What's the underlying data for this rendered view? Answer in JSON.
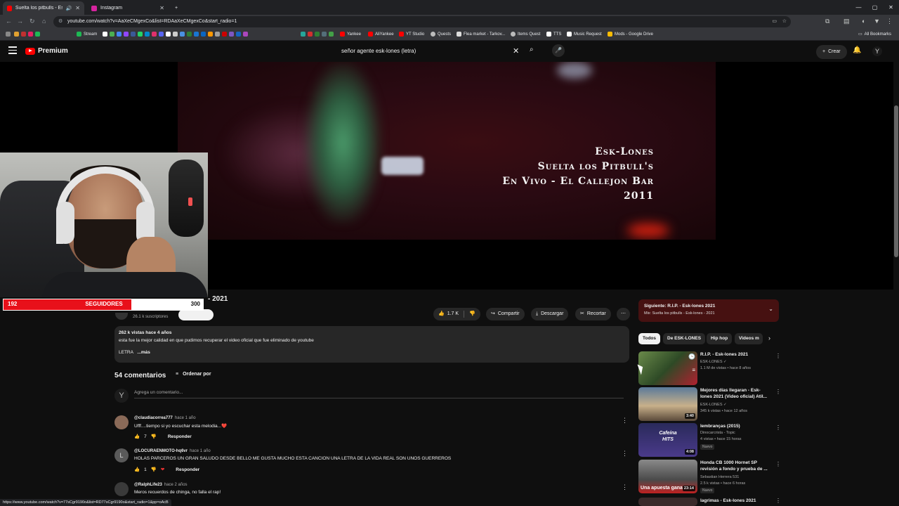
{
  "browser": {
    "tabs": [
      {
        "title": "Suelta los pitbulls - Esk-lones",
        "active": true
      },
      {
        "title": "Instagram",
        "active": false
      }
    ],
    "url": "youtube.com/watch?v=AaXeCMgexCo&list=RDAaXeCMgexCo&start_radio=1",
    "bookmarks": [
      "Stream",
      "Yankee",
      "AliYankee",
      "YT Studio",
      "Quests",
      "Flea market - Tarkov...",
      "Items Quest",
      "TTS",
      "Music Request",
      "Mods - Google Drive"
    ],
    "all_bookmarks": "All Bookmarks",
    "status_url": "https://www.youtube.com/watch?v=77sCgr9190o&list=RD77sCgr9190o&start_radio=1&pp=oAcB"
  },
  "youtube": {
    "logo_text": "Premium",
    "search_query": "señor agente esk-lones (letra)",
    "create_label": "Crear"
  },
  "video": {
    "caption_lines": [
      "Esk-Lones",
      "Suelta los Pitbull's",
      "En Vivo - El Callejon Bar",
      "2011"
    ],
    "title_visible": "- 2021",
    "subscribers": "26.1 k suscriptores",
    "likes": "1.7 K",
    "share_label": "Compartir",
    "download_label": "Descargar",
    "clip_label": "Recortar",
    "description": {
      "stats": "262 k vistas  hace 4 años",
      "text": "esta fue la mejor calidad en que pudimos recuperar el video oficial que fue eliminado de youtube",
      "lyrics": "LETRA",
      "more": "...más"
    }
  },
  "overlay": {
    "followers_current": "192",
    "followers_label": "SEGUIDORES",
    "followers_goal": "300",
    "progress_fraction": 0.64
  },
  "comments": {
    "count_label": "54 comentarios",
    "sort_label": "Ordenar por",
    "add_placeholder": "Agrega un comentario...",
    "reply_label": "Responder",
    "items": [
      {
        "author": "@claudiacorrea777",
        "time": "hace 1 año",
        "text": "Ufff....tiempo si yo escuchar esta melodia...❤️",
        "likes": "7"
      },
      {
        "author": "@LOCURAENMOTO-hq6vr",
        "time": "hace 1 año",
        "text": "HOLAS PARCEROS UN  GRAN SALUDO DESDE BELLO ME GUSTA MUCHO ESTA CANCION UNA LETRA  DE LA VIDA REAL SON UNOS GUERREROS",
        "likes": "1",
        "avatar_letter": "L"
      },
      {
        "author": "@RalphLife23",
        "time": "hace 2 años",
        "text": "Meros recuerdos de chinga, no falla el rap!",
        "likes": ""
      }
    ]
  },
  "sidebar": {
    "next_label": "Siguiente: R.I.P. - Esk-lones 2021",
    "next_sub": "Mix: Suelta los pitbulls - Esk-lones - 2021",
    "chips": [
      "Todos",
      "De ESK-LONES",
      "Hip hop",
      "Videos m"
    ],
    "recommendations": [
      {
        "title": "R.I.P. - Esk-lones 2021",
        "channel": "ESK-LONES ✓",
        "meta": "1.1 M de vistas • hace 8 años",
        "duration": ""
      },
      {
        "title": "Mejores días llegaran - Esk-lones 2021 (Video oficial) Atil...",
        "channel": "ESK-LONES ✓",
        "meta": "345 k vistas • hace 12 años",
        "duration": "3:40"
      },
      {
        "title": "lembranças (2015)",
        "channel": "Dinocarcrista - Topic",
        "meta": "4 vistas • hace 15 horas",
        "duration": "4:08",
        "badge": "Nuevo",
        "thumb_text": "Cafeína HITS"
      },
      {
        "title": "Honda CB 1000 Hornet SP revisión a fondo y prueba de ...",
        "channel": "Sebastian Herrera 531",
        "meta": "2.5 k vistas • hace 6 horas",
        "duration": "23:14",
        "badge": "Nuevo",
        "thumb_text": "Una apuesta gana"
      },
      {
        "title": "lagrimas - Esk-lones 2021",
        "channel": "",
        "meta": "",
        "duration": ""
      }
    ]
  }
}
